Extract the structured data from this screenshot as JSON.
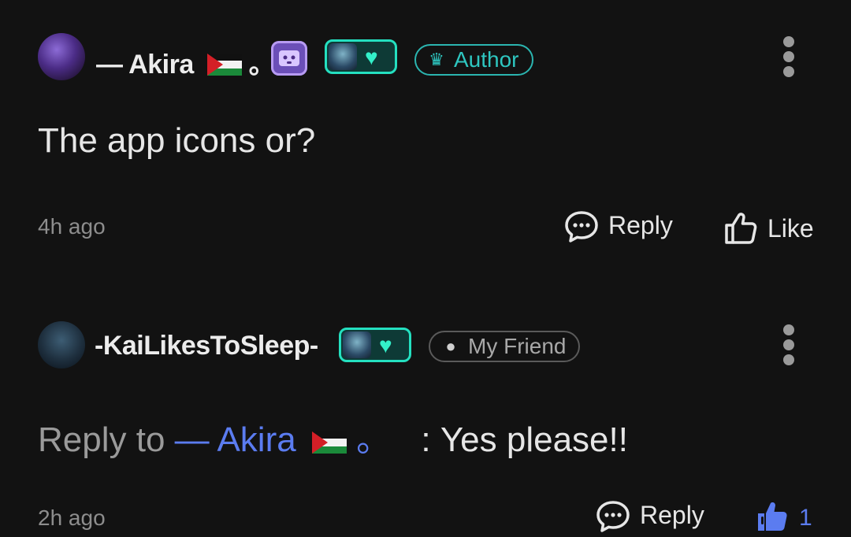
{
  "comments": [
    {
      "username": "— Akira",
      "username_suffix": "。",
      "tag_label": "Author",
      "tag_icon": "crown-icon",
      "text": "The app icons or?",
      "time": "4h ago",
      "reply_label": "Reply",
      "like_label": "Like"
    },
    {
      "username": "-KaiLikesToSleep-",
      "tag_label": "My Friend",
      "tag_icon": "heart-face-icon",
      "reply_prefix": "Reply to",
      "mention": "— Akira",
      "mention_suffix": "。",
      "text": ": Yes please!!",
      "time": "2h ago",
      "reply_label": "Reply",
      "like_count": "1"
    }
  ],
  "colors": {
    "background": "#121212",
    "author_accent": "#2ec6c0",
    "mention_blue": "#5b7cf0",
    "muted_text": "#8d8d8d"
  }
}
